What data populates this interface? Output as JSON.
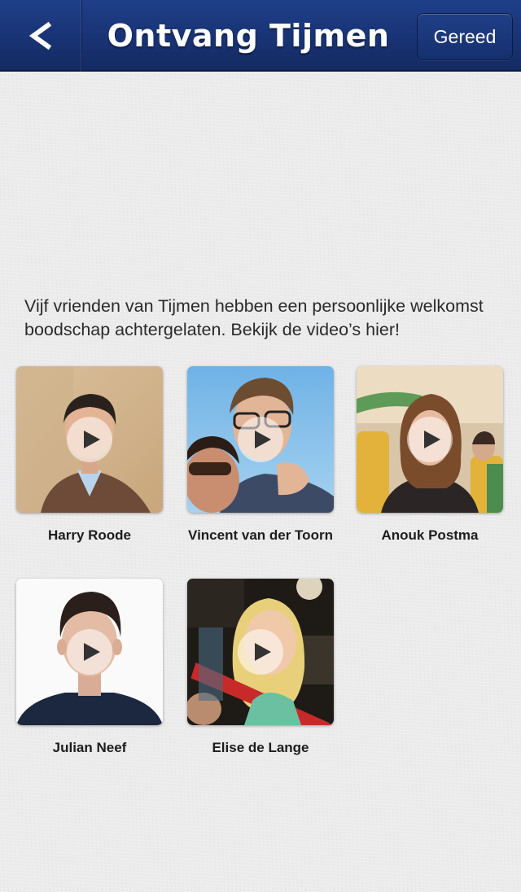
{
  "nav": {
    "back_label": "<",
    "title": "Ontvang Tijmen",
    "done_label": "Gereed"
  },
  "intro_text": "Vijf vrienden van Tijmen hebben een persoonlijke welkomst boodschap achtergelaten. Bekijk de video’s hier!",
  "videos": [
    {
      "name": "Harry Roode",
      "icon": "play-icon"
    },
    {
      "name": "Vincent van der Toorn",
      "icon": "play-icon"
    },
    {
      "name": "Anouk Postma",
      "icon": "play-icon"
    },
    {
      "name": "Julian Neef",
      "icon": "play-icon"
    },
    {
      "name": "Elise de Lange",
      "icon": "play-icon"
    }
  ],
  "colors": {
    "navbar": "#193476",
    "background": "#ebebeb",
    "text": "#2a2a2a"
  }
}
